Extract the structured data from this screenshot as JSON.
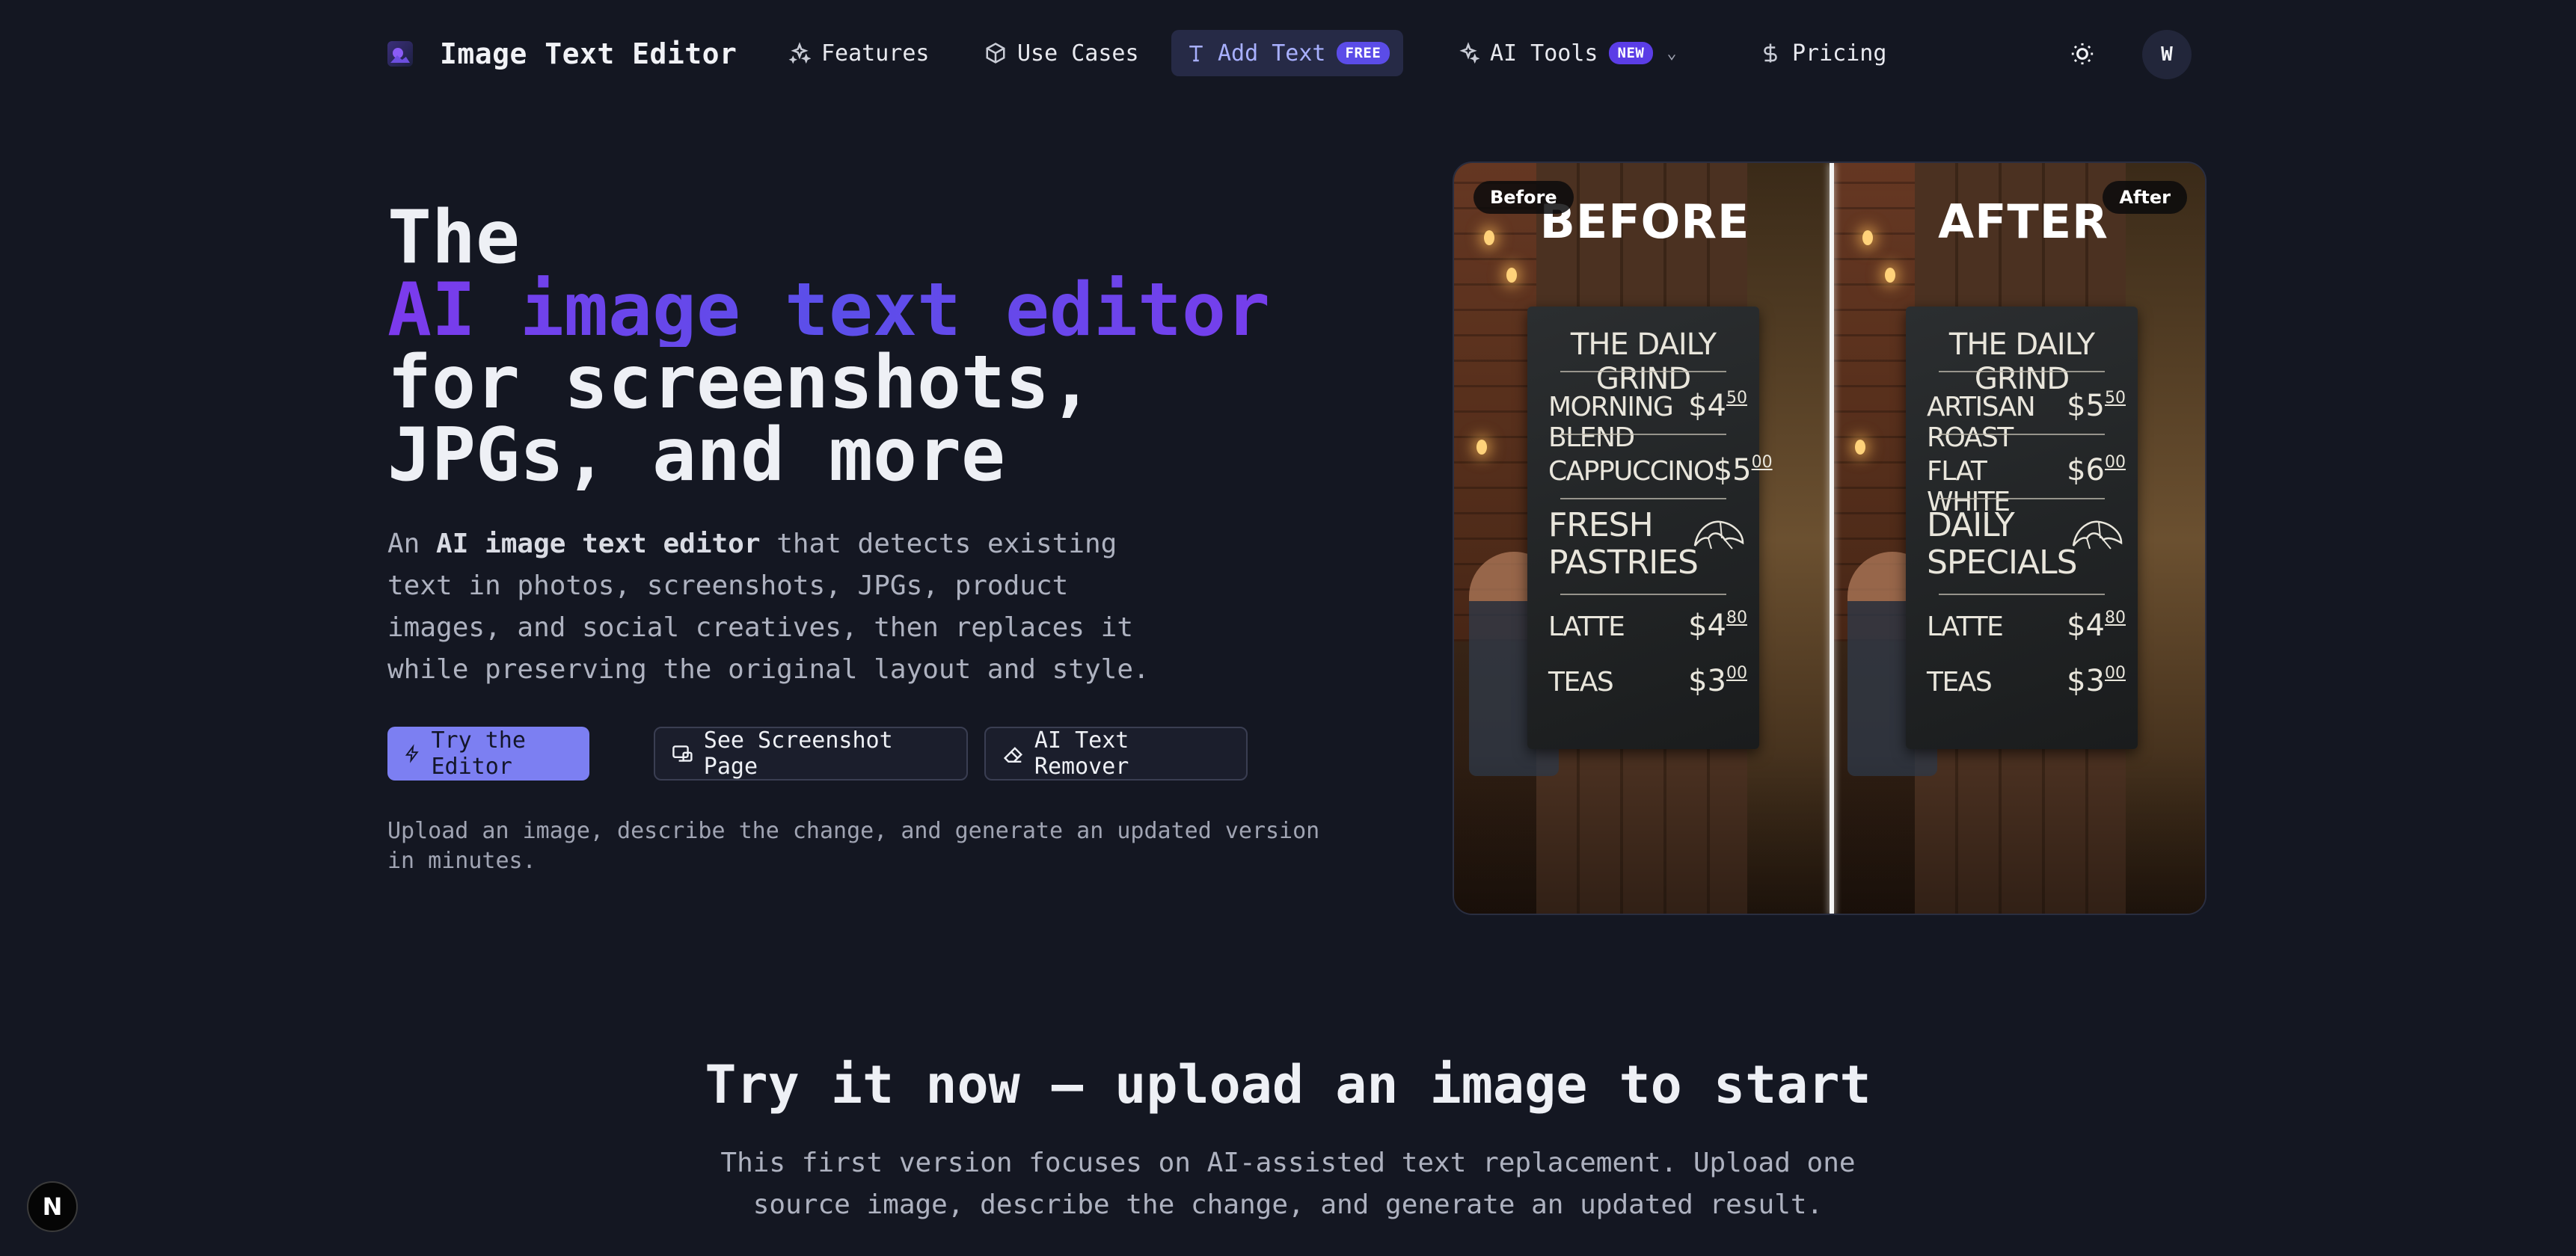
{
  "brand": {
    "name": "Image Text Editor"
  },
  "nav": {
    "features": "Features",
    "use_cases": "Use Cases",
    "add_text": "Add Text",
    "add_text_badge": "FREE",
    "ai_tools": "AI Tools",
    "ai_tools_badge": "NEW",
    "pricing": "Pricing"
  },
  "user": {
    "avatar_initial": "W"
  },
  "hero": {
    "title_line1": "The",
    "title_line2": "AI image text editor",
    "title_line3": "for screenshots,",
    "title_line4": "JPGs, and more",
    "desc_prefix": "An ",
    "desc_bold": "AI image text editor",
    "desc_rest": " that detects existing text in photos, screenshots, JPGs, product images, and social creatives, then replaces it while preserving the original layout and style.",
    "cta_primary": "Try the Editor",
    "cta_screenshot": "See Screenshot Page",
    "cta_remover": "AI Text Remover",
    "note": "Upload an image, describe the change, and generate an updated version in minutes."
  },
  "compare": {
    "before_tag": "Before",
    "after_tag": "After",
    "before": {
      "heading": "BEFORE",
      "board_title": "THE DAILY GRIND",
      "items": [
        {
          "name": "MORNING BLEND",
          "price": "$4",
          "cents": "50"
        },
        {
          "name": "CAPPUCCINO",
          "price": "$5",
          "cents": "00"
        }
      ],
      "multi": "FRESH PASTRIES",
      "items2": [
        {
          "name": "LATTE",
          "price": "$4",
          "cents": "80"
        },
        {
          "name": "TEAS",
          "price": "$3",
          "cents": "00"
        }
      ]
    },
    "after": {
      "heading": "AFTER",
      "board_title": "THE DAILY GRIND",
      "items": [
        {
          "name": "ARTISAN ROAST",
          "price": "$5",
          "cents": "50"
        },
        {
          "name": "FLAT WHITE",
          "price": "$6",
          "cents": "00"
        }
      ],
      "multi": "DAILY SPECIALS",
      "items2": [
        {
          "name": "LATTE",
          "price": "$4",
          "cents": "80"
        },
        {
          "name": "TEAS",
          "price": "$3",
          "cents": "00"
        }
      ]
    }
  },
  "section2": {
    "title": "Try it now — upload an image to start",
    "desc": "This first version focuses on AI-assisted text replacement. Upload one source image, describe the change, and generate an updated result."
  },
  "dev_badge": "N",
  "colors": {
    "background": "#141722",
    "accent_purple": "#7c3aed",
    "primary_button": "#7c7ff2",
    "badge": "#5b4ce8"
  },
  "icons": {
    "features": "sparkles-icon",
    "use_cases": "box-icon",
    "add_text": "type-icon",
    "ai_tools": "sparkles-icon",
    "pricing": "dollar-icon",
    "theme": "sun-icon",
    "try_editor": "zap-icon",
    "screenshot": "screenshot-icon",
    "remover": "eraser-icon"
  }
}
